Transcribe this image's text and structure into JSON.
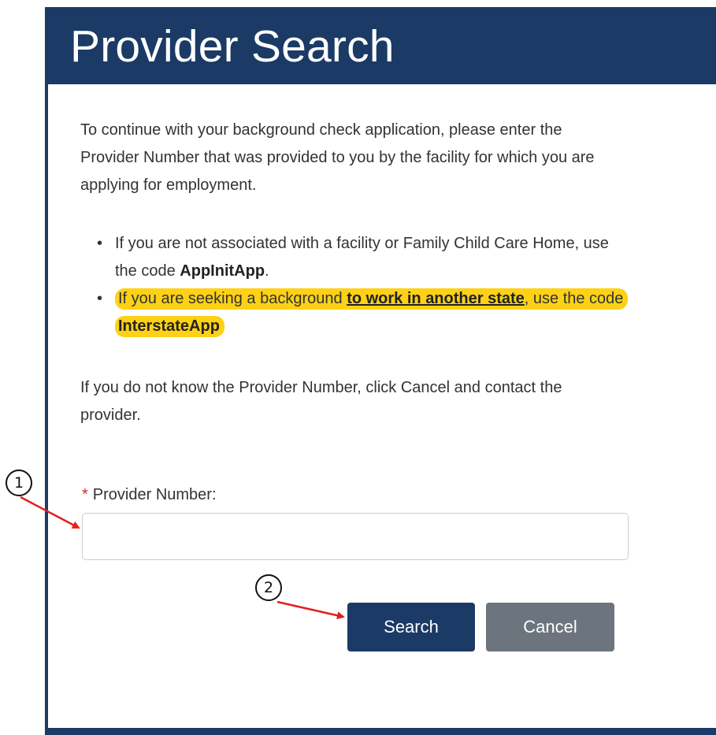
{
  "header": {
    "title": "Provider Search"
  },
  "intro": "To continue with your background check application, please enter the Provider Number that was provided to you by the facility for which you are applying for employment.",
  "bullets": {
    "item1": {
      "text_before": "If you are not associated with a facility or Family Child Care Home, use the code ",
      "code": "AppInitApp",
      "text_after": "."
    },
    "item2": {
      "text_before": "If you are seeking a background ",
      "link": "to work in another state",
      "text_middle": ", use the code ",
      "code": "InterstateApp"
    }
  },
  "note": "If you do not know the Provider Number, click Cancel and contact the provider.",
  "form": {
    "required_mark": "*",
    "label": "Provider Number:",
    "value": "",
    "placeholder": ""
  },
  "buttons": {
    "search": "Search",
    "cancel": "Cancel"
  },
  "callouts": {
    "one": "1",
    "two": "2"
  },
  "colors": {
    "header_bg": "#1b3a66",
    "highlight": "#fdd116",
    "search_button": "#1b3a66",
    "cancel_button": "#6c757d",
    "required": "#d62d20",
    "annotation_arrow": "#e02020"
  }
}
